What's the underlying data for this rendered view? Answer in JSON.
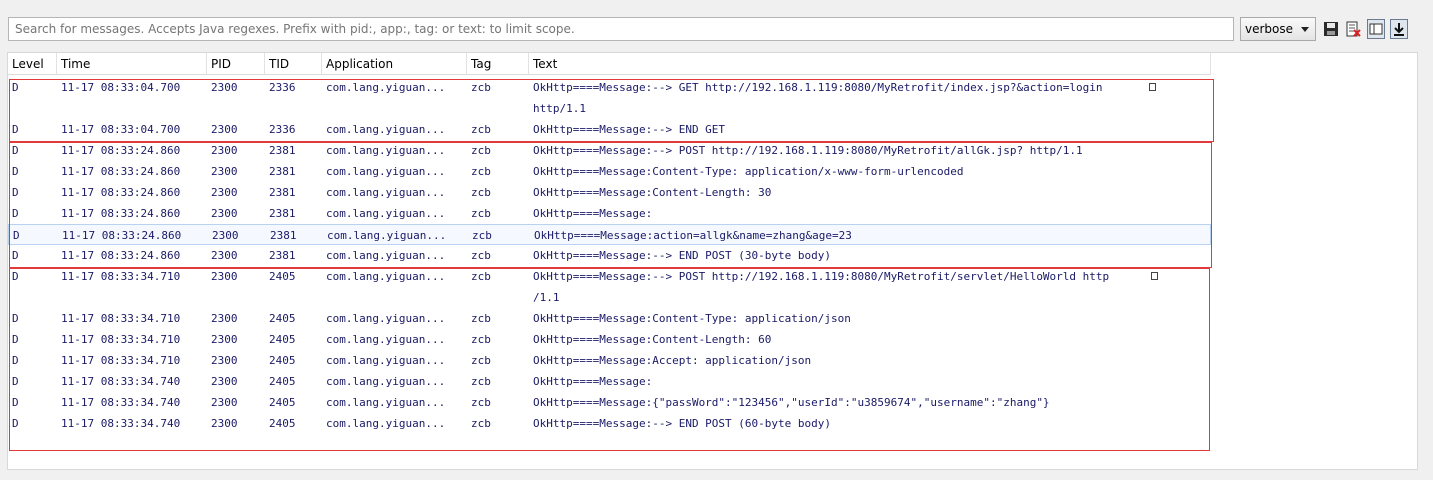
{
  "search": {
    "placeholder": "Search for messages. Accepts Java regexes. Prefix with pid:, app:, tag: or text: to limit scope."
  },
  "level_select": {
    "value": "verbose"
  },
  "toolbar_icons": [
    "save-icon",
    "clear-log-icon",
    "toggle-view-icon",
    "scroll-lock-icon"
  ],
  "columns": [
    "Level",
    "Time",
    "PID",
    "TID",
    "Application",
    "Tag",
    "Text"
  ],
  "rows": [
    {
      "level": "D",
      "time": "11-17 08:33:04.700",
      "pid": "2300",
      "tid": "2336",
      "app": "com.lang.yiguan...",
      "tag": "zcb",
      "text": "OkHttp====Message:--> GET http://192.168.1.119:8080/MyRetrofit/index.jsp?&action=login",
      "cont": "http/1.1"
    },
    {
      "level": "D",
      "time": "11-17 08:33:04.700",
      "pid": "2300",
      "tid": "2336",
      "app": "com.lang.yiguan...",
      "tag": "zcb",
      "text": "OkHttp====Message:--> END GET"
    },
    {
      "level": "D",
      "time": "11-17 08:33:24.860",
      "pid": "2300",
      "tid": "2381",
      "app": "com.lang.yiguan...",
      "tag": "zcb",
      "text": "OkHttp====Message:--> POST http://192.168.1.119:8080/MyRetrofit/allGk.jsp? http/1.1"
    },
    {
      "level": "D",
      "time": "11-17 08:33:24.860",
      "pid": "2300",
      "tid": "2381",
      "app": "com.lang.yiguan...",
      "tag": "zcb",
      "text": "OkHttp====Message:Content-Type: application/x-www-form-urlencoded"
    },
    {
      "level": "D",
      "time": "11-17 08:33:24.860",
      "pid": "2300",
      "tid": "2381",
      "app": "com.lang.yiguan...",
      "tag": "zcb",
      "text": "OkHttp====Message:Content-Length: 30"
    },
    {
      "level": "D",
      "time": "11-17 08:33:24.860",
      "pid": "2300",
      "tid": "2381",
      "app": "com.lang.yiguan...",
      "tag": "zcb",
      "text": "OkHttp====Message:"
    },
    {
      "level": "D",
      "time": "11-17 08:33:24.860",
      "pid": "2300",
      "tid": "2381",
      "app": "com.lang.yiguan...",
      "tag": "zcb",
      "text": "OkHttp====Message:action=allgk&name=zhang&age=23",
      "selected": true
    },
    {
      "level": "D",
      "time": "11-17 08:33:24.860",
      "pid": "2300",
      "tid": "2381",
      "app": "com.lang.yiguan...",
      "tag": "zcb",
      "text": "OkHttp====Message:--> END POST (30-byte body)"
    },
    {
      "level": "D",
      "time": "11-17 08:33:34.710",
      "pid": "2300",
      "tid": "2405",
      "app": "com.lang.yiguan...",
      "tag": "zcb",
      "text": "OkHttp====Message:--> POST http://192.168.1.119:8080/MyRetrofit/servlet/HelloWorld http",
      "cont": "/1.1"
    },
    {
      "level": "D",
      "time": "11-17 08:33:34.710",
      "pid": "2300",
      "tid": "2405",
      "app": "com.lang.yiguan...",
      "tag": "zcb",
      "text": "OkHttp====Message:Content-Type: application/json"
    },
    {
      "level": "D",
      "time": "11-17 08:33:34.710",
      "pid": "2300",
      "tid": "2405",
      "app": "com.lang.yiguan...",
      "tag": "zcb",
      "text": "OkHttp====Message:Content-Length: 60"
    },
    {
      "level": "D",
      "time": "11-17 08:33:34.710",
      "pid": "2300",
      "tid": "2405",
      "app": "com.lang.yiguan...",
      "tag": "zcb",
      "text": "OkHttp====Message:Accept: application/json"
    },
    {
      "level": "D",
      "time": "11-17 08:33:34.740",
      "pid": "2300",
      "tid": "2405",
      "app": "com.lang.yiguan...",
      "tag": "zcb",
      "text": "OkHttp====Message:"
    },
    {
      "level": "D",
      "time": "11-17 08:33:34.740",
      "pid": "2300",
      "tid": "2405",
      "app": "com.lang.yiguan...",
      "tag": "zcb",
      "text": "OkHttp====Message:{\"passWord\":\"123456\",\"userId\":\"u3859674\",\"username\":\"zhang\"}"
    },
    {
      "level": "D",
      "time": "11-17 08:33:34.740",
      "pid": "2300",
      "tid": "2405",
      "app": "com.lang.yiguan...",
      "tag": "zcb",
      "text": "OkHttp====Message:--> END POST (60-byte body)"
    }
  ],
  "colors": {
    "highlight_box": "#e23a3a",
    "log_text": "#1a1a66",
    "selected_row": "#f5f9ff"
  }
}
